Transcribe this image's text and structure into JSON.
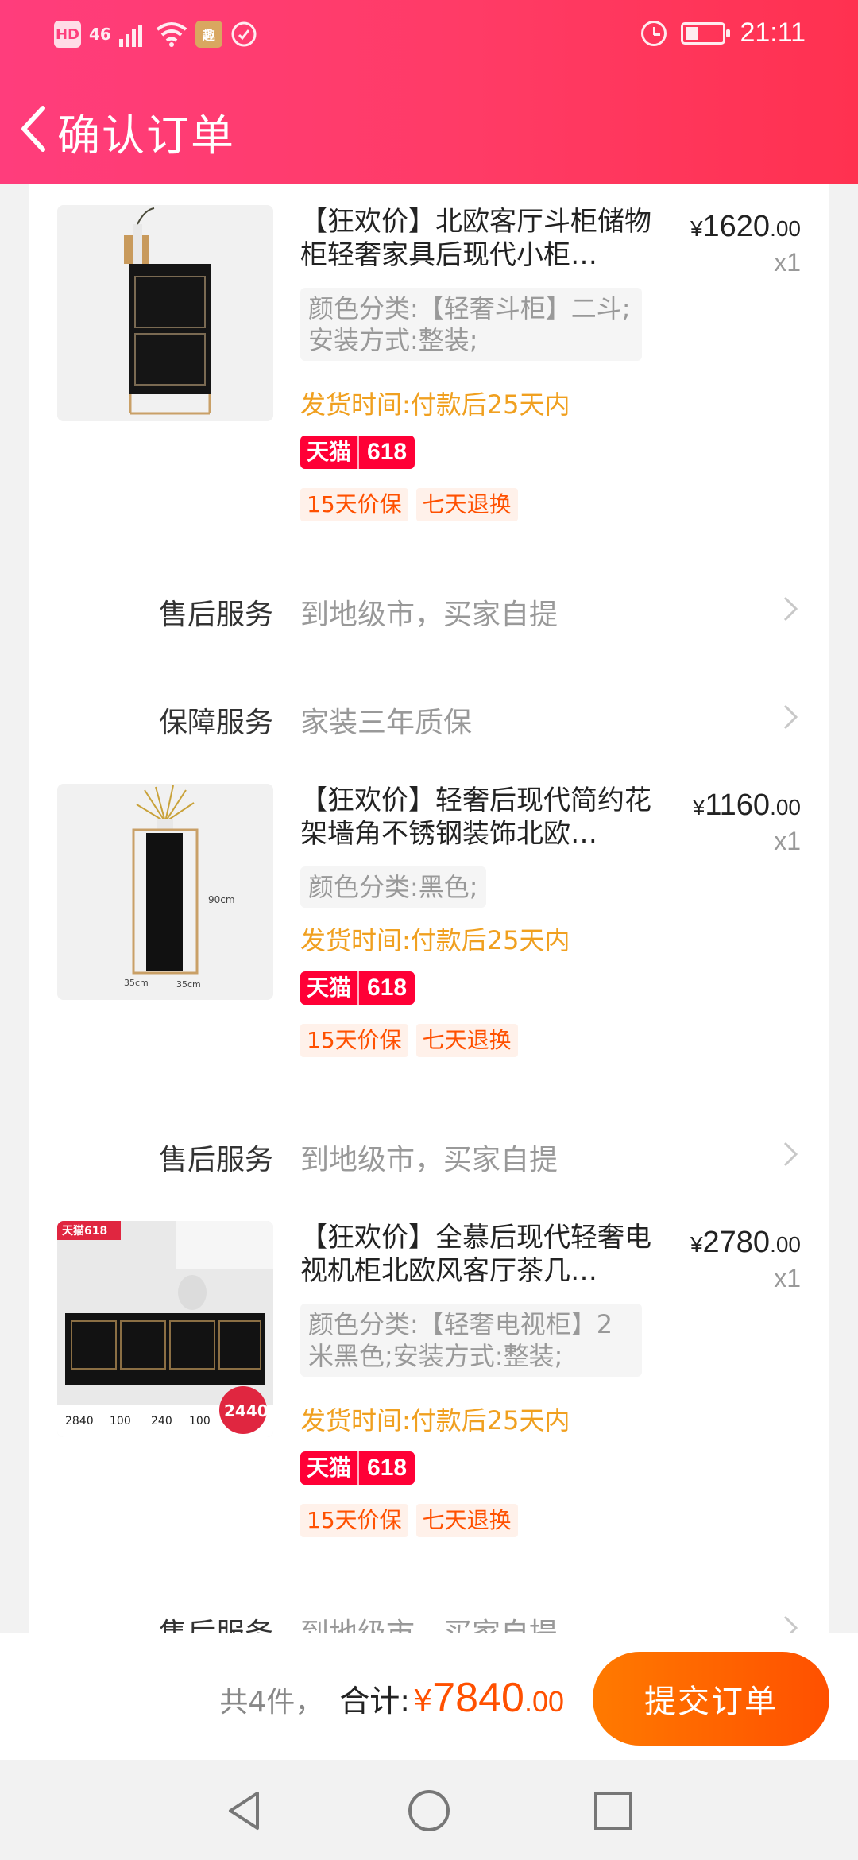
{
  "status_bar": {
    "left_labels": [
      "HD",
      "46"
    ],
    "time": "21:11",
    "icons": [
      "signal-icon",
      "wifi-icon",
      "app-notification-icon",
      "shield-icon",
      "alarm-icon",
      "battery-icon"
    ]
  },
  "header": {
    "title": "确认订单",
    "accent": "#ff3b66"
  },
  "products": [
    {
      "title": "【狂欢价】北欧客厅斗柜储物柜轻奢家具后现代小柜…",
      "price_currency": "¥",
      "price_int": "1620",
      "price_dec": ".00",
      "qty": "x1",
      "spec": "颜色分类:【轻奢斗柜】二斗;安装方式:整装;",
      "ship": "发货时间:付款后25天内",
      "badge_left": "天猫",
      "badge_right": "618",
      "tags": [
        "15天价保",
        "七天退换"
      ]
    },
    {
      "title": "【狂欢价】轻奢后现代简约花架墙角不锈钢装饰北欧…",
      "price_currency": "¥",
      "price_int": "1160",
      "price_dec": ".00",
      "qty": "x1",
      "spec": "颜色分类:黑色;",
      "ship": "发货时间:付款后25天内",
      "badge_left": "天猫",
      "badge_right": "618",
      "tags": [
        "15天价保",
        "七天退换"
      ],
      "dim_labels": [
        "90cm",
        "35cm",
        "35cm"
      ]
    },
    {
      "title": "【狂欢价】全慕后现代轻奢电视机柜北欧风客厅茶几…",
      "price_currency": "¥",
      "price_int": "2780",
      "price_dec": ".00",
      "qty": "x1",
      "spec": "颜色分类:【轻奢电视柜】2米黑色;安装方式:整装;",
      "ship": "发货时间:付款后25天内",
      "badge_left": "天猫",
      "badge_right": "618",
      "tags": [
        "15天价保",
        "七天退换"
      ],
      "thumb_badge": "天猫618",
      "thumb_price": "2440",
      "thumb_stats": [
        "2840",
        "100",
        "240",
        "100"
      ]
    }
  ],
  "services": [
    {
      "label": "售后服务",
      "value": "到地级市，买家自提"
    },
    {
      "label": "保障服务",
      "value": "家装三年质保"
    },
    {
      "label": "售后服务",
      "value": "到地级市，买家自提"
    },
    {
      "label": "售后服务",
      "value": "到地级市，买家自提"
    }
  ],
  "footer": {
    "count": "共4件，",
    "total_label": "合计:",
    "total_currency": "¥",
    "total_int": "7840",
    "total_dec": ".00",
    "submit": "提交订单",
    "price_color": "#ff5000"
  }
}
